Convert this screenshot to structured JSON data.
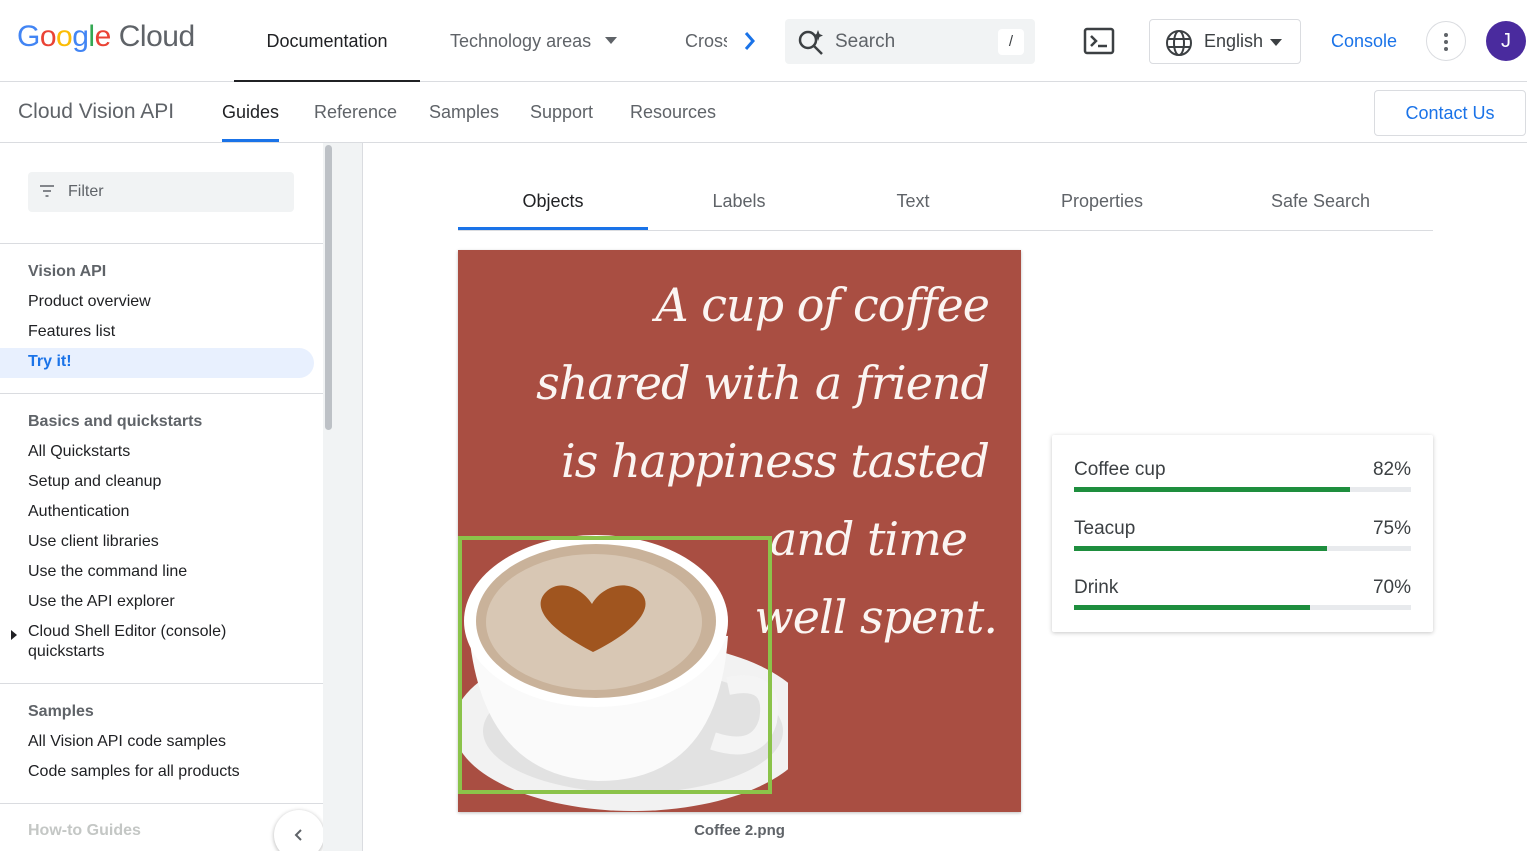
{
  "header": {
    "logo_google": "Google",
    "logo_cloud": "Cloud",
    "nav": [
      "Documentation",
      "Technology areas",
      "Cross"
    ],
    "search_placeholder": "Search",
    "search_shortcut": "/",
    "language": "English",
    "console": "Console",
    "avatar_initial": "J"
  },
  "subheader": {
    "product": "Cloud Vision API",
    "tabs": [
      "Guides",
      "Reference",
      "Samples",
      "Support",
      "Resources"
    ],
    "active_tab": "Guides",
    "contact": "Contact Us"
  },
  "sidebar": {
    "filter_placeholder": "Filter",
    "sections": [
      {
        "heading": "Vision API",
        "items": [
          "Product overview",
          "Features list",
          "Try it!"
        ]
      },
      {
        "heading": "Basics and quickstarts",
        "items": [
          "All Quickstarts",
          "Setup and cleanup",
          "Authentication",
          "Use client libraries",
          "Use the command line",
          "Use the API explorer",
          "Cloud Shell Editor (console) quickstarts"
        ]
      },
      {
        "heading": "Samples",
        "items": [
          "All Vision API code samples",
          "Code samples for all products"
        ]
      }
    ],
    "active_item": "Try it!",
    "faded_heading": "How-to Guides"
  },
  "demo": {
    "tabs": [
      "Objects",
      "Labels",
      "Text",
      "Properties",
      "Safe Search"
    ],
    "active_tab": "Objects",
    "image_text": [
      "A cup of coffee",
      "shared with a friend",
      "is happiness tasted",
      "and time",
      "well spent."
    ],
    "image_caption": "Coffee 2.png",
    "results": [
      {
        "name": "Coffee cup",
        "pct_label": "82%",
        "score": 0.82
      },
      {
        "name": "Teacup",
        "pct_label": "75%",
        "score": 0.75
      },
      {
        "name": "Drink",
        "pct_label": "70%",
        "score": 0.7
      }
    ]
  },
  "colors": {
    "accent": "#1a73e8",
    "image_bg": "#a94e42",
    "bbox": "#8bc34a",
    "result_bar": "#1e8e3e",
    "avatar": "#4a2b9e"
  }
}
